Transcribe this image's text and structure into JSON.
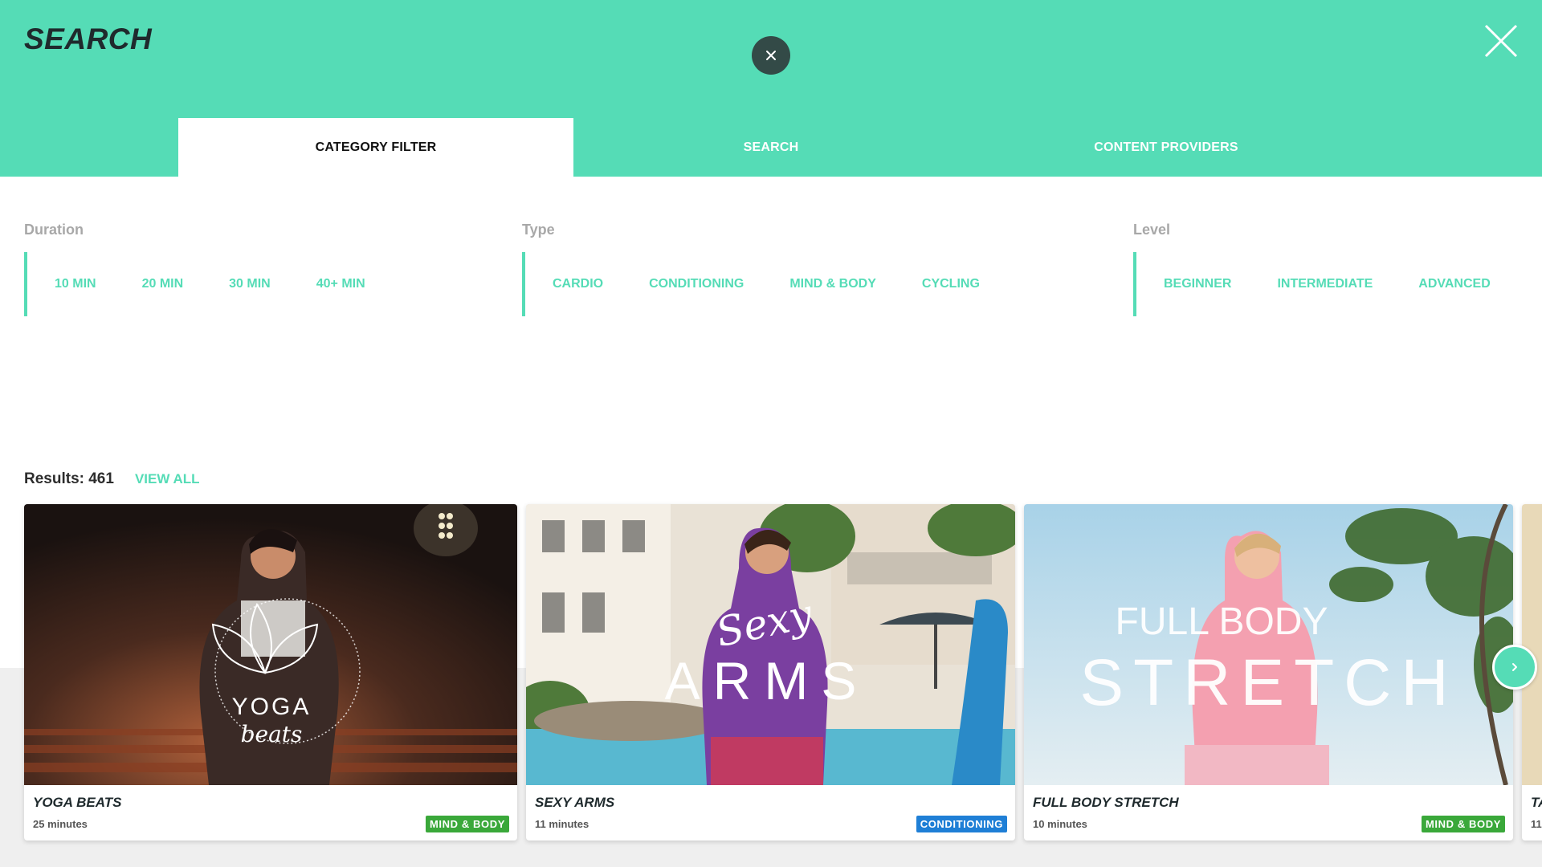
{
  "header": {
    "title": "SEARCH",
    "background": "#55dcb6"
  },
  "icons": {
    "center_close": "close-icon",
    "top_close": "close-icon",
    "next": "chevron-right-icon"
  },
  "tabs": [
    {
      "label": "CATEGORY FILTER",
      "active": true
    },
    {
      "label": "SEARCH",
      "active": false
    },
    {
      "label": "CONTENT PROVIDERS",
      "active": false
    }
  ],
  "filters": {
    "duration": {
      "title": "Duration",
      "options": [
        "10 MIN",
        "20 MIN",
        "30 MIN",
        "40+ MIN"
      ]
    },
    "type": {
      "title": "Type",
      "options": [
        "CARDIO",
        "CONDITIONING",
        "MIND & BODY",
        "CYCLING"
      ]
    },
    "level": {
      "title": "Level",
      "options": [
        "BEGINNER",
        "INTERMEDIATE",
        "ADVANCED"
      ]
    }
  },
  "results": {
    "label": "Results: 461",
    "view_all": "VIEW ALL"
  },
  "cards": [
    {
      "title": "YOGA BEATS",
      "duration": "25 minutes",
      "badge": "MIND & BODY",
      "badge_color": "#3aa83a",
      "overlay_line1": "YOGA",
      "overlay_line2": "beats"
    },
    {
      "title": "SEXY ARMS",
      "duration": "11 minutes",
      "badge": "CONDITIONING",
      "badge_color": "#1f7fd6",
      "overlay_line1": "Sexy",
      "overlay_line2": "ARMS"
    },
    {
      "title": "FULL BODY STRETCH",
      "duration": "10 minutes",
      "badge": "MIND & BODY",
      "badge_color": "#3aa83a",
      "overlay_line1": "FULL BODY",
      "overlay_line2": "STRETCH"
    },
    {
      "title": "TA",
      "duration": "11"
    }
  ],
  "colors": {
    "accent": "#55dcb6",
    "dark_button": "#334a47",
    "mind_body_badge": "#3aa83a",
    "conditioning_badge": "#1f7fd6"
  }
}
